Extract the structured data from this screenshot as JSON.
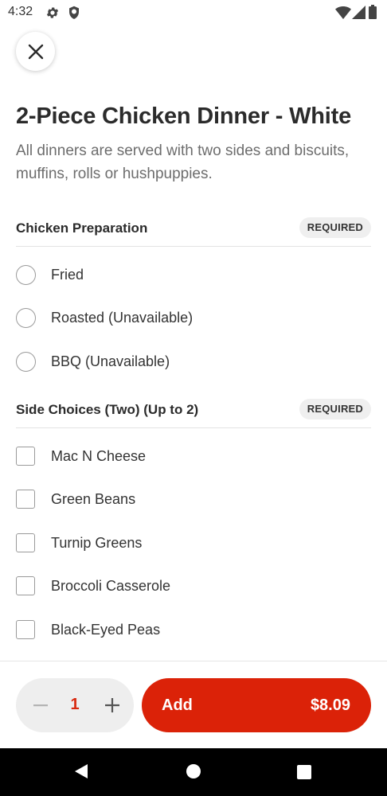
{
  "status_bar": {
    "time": "4:32",
    "icons": [
      "gear-icon",
      "shield-icon",
      "wifi-icon",
      "signal-icon",
      "battery-icon"
    ]
  },
  "item": {
    "title": "2-Piece Chicken Dinner - White",
    "description": "All dinners are served with two sides and biscuits, muffins, rolls or hushpuppies."
  },
  "sections": [
    {
      "title": "Chicken Preparation",
      "badge": "REQUIRED",
      "type": "radio",
      "options": [
        {
          "label": "Fried"
        },
        {
          "label": "Roasted (Unavailable)"
        },
        {
          "label": "BBQ (Unavailable)"
        }
      ]
    },
    {
      "title": "Side Choices (Two) (Up to 2)",
      "badge": "REQUIRED",
      "type": "checkbox",
      "options": [
        {
          "label": "Mac N Cheese"
        },
        {
          "label": "Green Beans"
        },
        {
          "label": "Turnip Greens"
        },
        {
          "label": "Broccoli Casserole"
        },
        {
          "label": "Black-Eyed Peas"
        }
      ]
    }
  ],
  "footer": {
    "quantity": "1",
    "add_label": "Add",
    "price": "$8.09"
  },
  "colors": {
    "accent": "#db2208",
    "quantity_text": "#d82a10",
    "badge_bg": "#efefef"
  }
}
